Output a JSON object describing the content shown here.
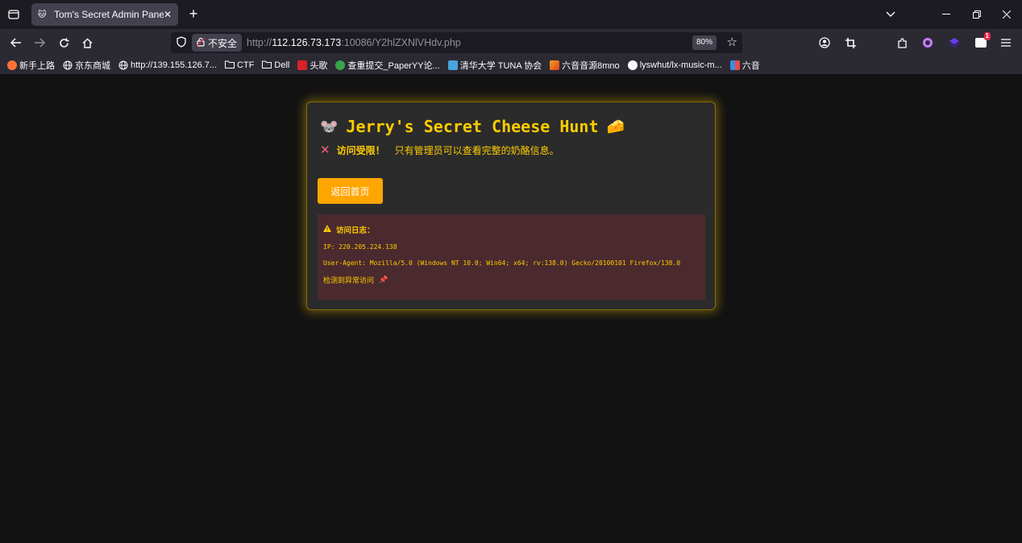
{
  "browser": {
    "tab": {
      "title": "Tom's Secret Admin Panel",
      "favicon": "cat-face-icon"
    },
    "address": {
      "security_label": "不安全",
      "url_prefix": "http://",
      "url_host": "112.126.73.173",
      "url_rest": ":10086/Y2hlZXNlVHdv.php",
      "zoom": "80%"
    },
    "extension_badge": "1",
    "bookmarks": [
      {
        "label": "新手上路",
        "icon": "firefox-icon",
        "color": "#ff7139"
      },
      {
        "label": "京东商城",
        "icon": "globe-icon",
        "color": "#fbfbfe"
      },
      {
        "label": "http://139.155.126.7...",
        "icon": "globe-icon",
        "color": "#fbfbfe"
      },
      {
        "label": "CTF",
        "icon": "folder-icon",
        "color": "#fbfbfe"
      },
      {
        "label": "Dell",
        "icon": "folder-icon",
        "color": "#fbfbfe"
      },
      {
        "label": "头歌",
        "icon": "toutiao-icon",
        "color": "#d7222a"
      },
      {
        "label": "查重提交_PaperYY论...",
        "icon": "paperyy-icon",
        "color": "#3aa44a"
      },
      {
        "label": "清华大学 TUNA 协会",
        "icon": "tuna-icon",
        "color": "#4aa3df"
      },
      {
        "label": "六音音源8mno",
        "icon": "chart-bookmark-icon",
        "color": "#f0a020"
      },
      {
        "label": "lyswhut/lx-music-m...",
        "icon": "github-icon",
        "color": "#fbfbfe"
      },
      {
        "label": "六音",
        "icon": "six-tone-icon",
        "color": "#3a8ee6"
      }
    ]
  },
  "page": {
    "title": "Jerry's Secret Cheese Hunt",
    "title_left_emoji": "🐭",
    "title_right_emoji": "🧀",
    "denied_strong": "访问受限！",
    "denied_text": "只有管理员可以查看完整的奶酪信息。",
    "home_button": "返回首页",
    "log": {
      "heading": "访问日志：",
      "ip_line": "IP: 220.205.224.138",
      "ua_line": "User-Agent: Mozilla/5.0 (Windows NT 10.0; Win64; x64; rv:138.0) Gecko/20100101 Firefox/138.0",
      "footer": "检测到异常访问"
    }
  }
}
